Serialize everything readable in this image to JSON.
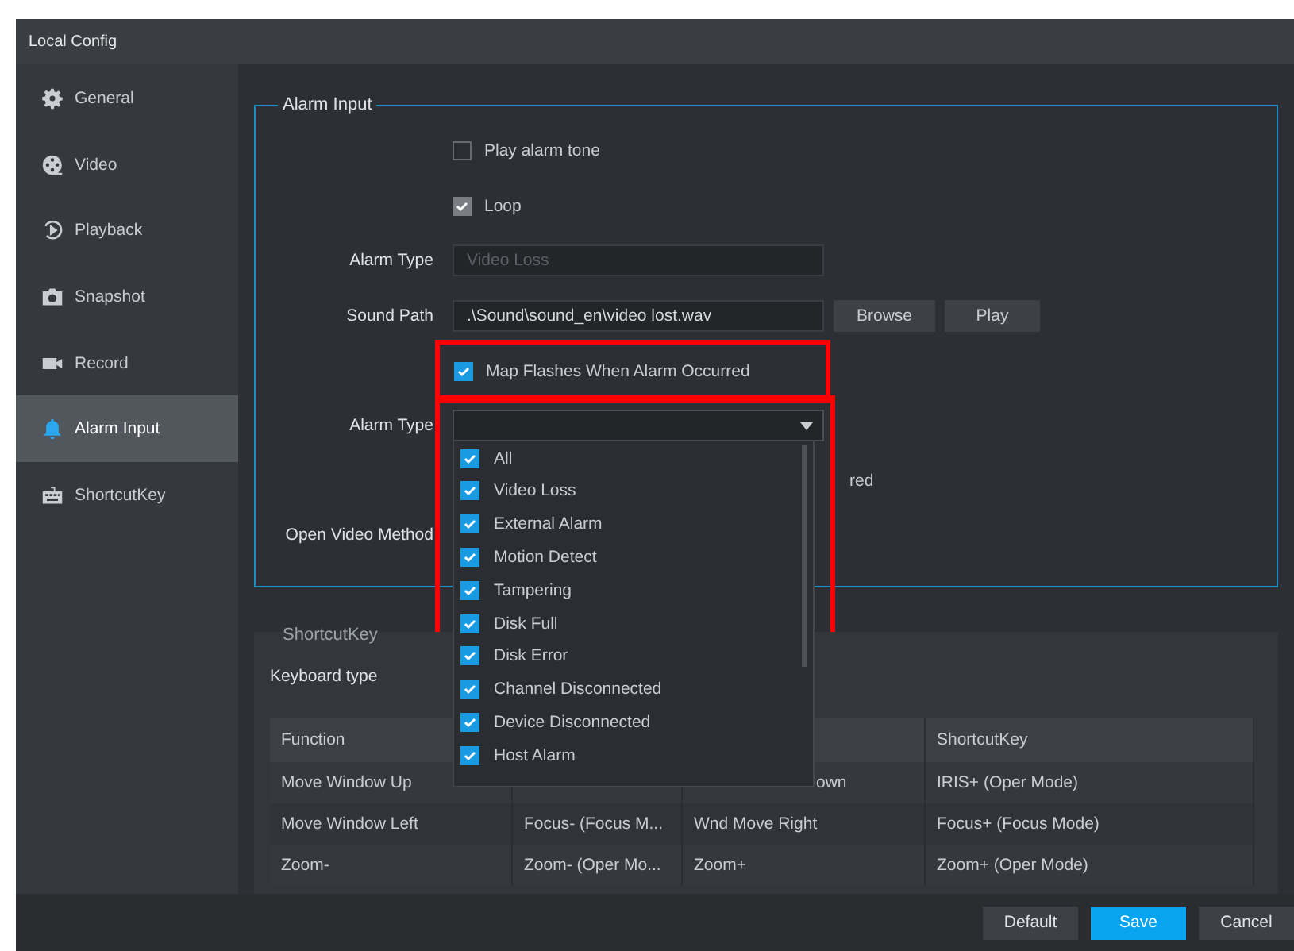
{
  "window": {
    "title": "Local Config"
  },
  "sidebar": {
    "items": [
      {
        "label": "General",
        "selected": false
      },
      {
        "label": "Video",
        "selected": false
      },
      {
        "label": "Playback",
        "selected": false
      },
      {
        "label": "Snapshot",
        "selected": false
      },
      {
        "label": "Record",
        "selected": false
      },
      {
        "label": "Alarm Input",
        "selected": true
      },
      {
        "label": "ShortcutKey",
        "selected": false
      }
    ]
  },
  "alarm_input": {
    "title": "Alarm Input",
    "play_alarm_tone": {
      "label": "Play alarm tone",
      "checked": false
    },
    "loop": {
      "label": "Loop",
      "checked": true,
      "disabled": true
    },
    "alarm_type": {
      "label": "Alarm Type",
      "value": "Video Loss",
      "disabled": true
    },
    "sound_path": {
      "label": "Sound Path",
      "value": ".\\Sound\\sound_en\\video lost.wav",
      "buttons": [
        "Browse",
        "Play"
      ]
    },
    "map_flashes": {
      "label": "Map Flashes When Alarm Occurred",
      "checked": true
    },
    "alarm_type_filter": {
      "label": "Alarm Type",
      "expanded": true,
      "options": [
        {
          "label": "All",
          "checked": true
        },
        {
          "label": "Video Loss",
          "checked": true
        },
        {
          "label": "External Alarm",
          "checked": true
        },
        {
          "label": "Motion Detect",
          "checked": true
        },
        {
          "label": "Tampering",
          "checked": true
        },
        {
          "label": "Disk Full",
          "checked": true
        },
        {
          "label": "Disk Error",
          "checked": true
        },
        {
          "label": "Channel Disconnected",
          "checked": true
        },
        {
          "label": "Device Disconnected",
          "checked": true
        },
        {
          "label": "Host Alarm",
          "checked": true
        }
      ]
    },
    "partial_text": "red",
    "open_video_method": {
      "label": "Open Video Method"
    }
  },
  "shortcut_key": {
    "title": "ShortcutKey",
    "keyboard_type": {
      "label": "Keyboard type"
    },
    "table": {
      "columns": {
        "column_1": "Function",
        "column_4": "ShortcutKey"
      },
      "rows": [
        {
          "column_1": "Move Window Up",
          "column_3": "own",
          "column_4": "IRIS+ (Oper Mode)"
        },
        {
          "column_1": "Move Window Left",
          "column_2": "Focus- (Focus M...",
          "column_3": "Wnd Move Right",
          "column_4": "Focus+ (Focus Mode)"
        },
        {
          "column_1": "Zoom-",
          "column_2": "Zoom- (Oper Mo...",
          "column_3": "Zoom+",
          "column_4": "Zoom+ (Oper Mode)"
        }
      ]
    }
  },
  "buttons": [
    {
      "label": "Default",
      "kind": "default"
    },
    {
      "label": "Save",
      "kind": "primary"
    },
    {
      "label": "Cancel",
      "kind": "default"
    }
  ]
}
